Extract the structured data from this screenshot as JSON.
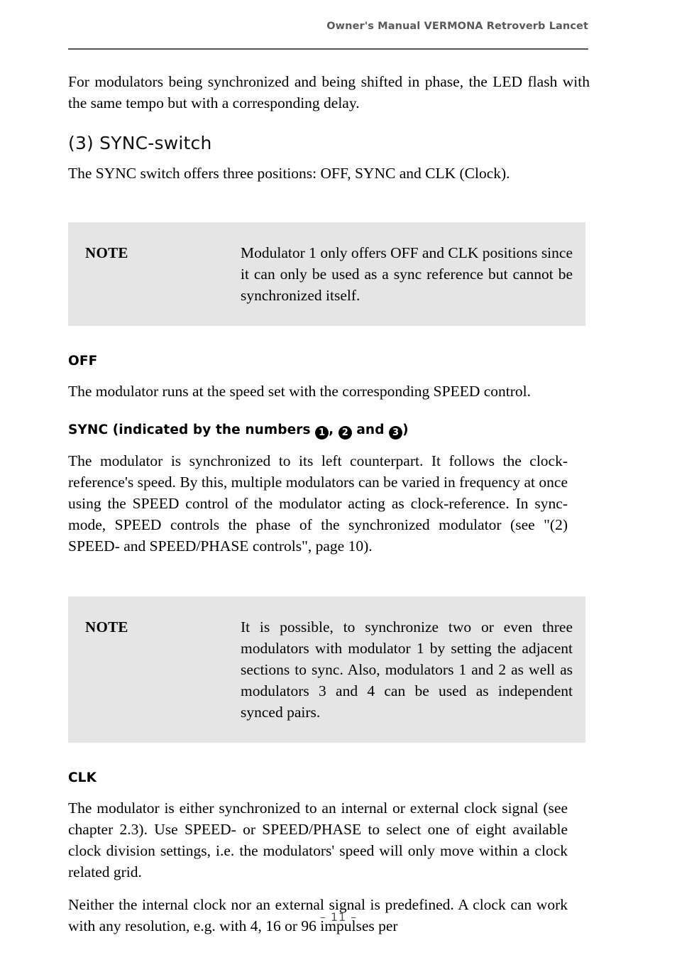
{
  "header": {
    "title": "Owner's Manual VERMONA Retroverb Lancet"
  },
  "content": {
    "intro_paragraph": "For modulators being synchronized and being shifted in phase, the LED flash with the same tempo but with a corresponding delay.",
    "section_heading": "(3) SYNC-switch",
    "section_intro": "The SYNC switch offers three positions: OFF, SYNC and CLK (Clock).",
    "note_1": {
      "label": "NOTE",
      "text": "Modulator 1 only offers OFF and CLK positions since it can only be used as a sync reference but cannot be synchronized itself."
    },
    "off": {
      "heading": "OFF",
      "paragraph": "The modulator runs at the speed set with the corresponding SPEED control."
    },
    "sync": {
      "heading_prefix": "SYNC (indicated by the numbers ",
      "badge_1": "1",
      "badge_sep_1": ", ",
      "badge_2": "2",
      "badge_sep_2": " and ",
      "badge_3": "3",
      "heading_suffix": ")",
      "paragraph": "The modulator is synchronized to its left counterpart. It follows the clock-reference's speed. By this, multiple modulators can be varied in frequency at once using the SPEED control of the modulator acting as clock-reference. In sync-mode, SPEED controls the phase of the synchronized modulator (see \"(2) SPEED- and SPEED/PHASE controls\", page 10)."
    },
    "note_2": {
      "label": "NOTE",
      "text": "It is possible, to synchronize two or even three modulators with modulator 1 by setting the adjacent sections to sync. Also, modulators 1 and 2 as well as modulators 3 and 4 can be used as independent synced pairs."
    },
    "clk": {
      "heading": "CLK",
      "paragraph_1": "The modulator is either synchronized to an internal or external clock signal (see chapter 2.3). Use SPEED- or SPEED/PHASE to select one of eight available clock division settings, i.e. the modulators' speed will only move within a clock related grid.",
      "paragraph_2": "Neither the internal clock nor an external signal is predefined. A clock can work with any resolution, e.g. with 4, 16 or 96 impulses per"
    }
  },
  "footer": {
    "page_number": "– 11 –"
  },
  "colors": {
    "note_background": "#e5e5e5",
    "header_text": "#5a5a5a",
    "rule": "#555555",
    "body_text": "#000000"
  }
}
